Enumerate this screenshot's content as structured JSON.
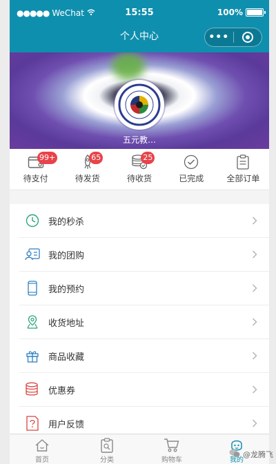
{
  "status_bar": {
    "carrier": "WeChat",
    "time": "15:55",
    "battery": "100%"
  },
  "nav": {
    "title": "个人中心",
    "more_icon": "more-dots-icon",
    "close_icon": "close-ring-icon"
  },
  "profile": {
    "username": "五元教…"
  },
  "orders": [
    {
      "label": "待支付",
      "badge": "99+",
      "icon": "wallet-icon"
    },
    {
      "label": "待发货",
      "badge": "65",
      "icon": "rocket-icon"
    },
    {
      "label": "待收货",
      "badge": "25",
      "icon": "coins-icon"
    },
    {
      "label": "已完成",
      "badge": "",
      "icon": "check-circle-icon"
    },
    {
      "label": "全部订单",
      "badge": "",
      "icon": "clipboard-icon"
    }
  ],
  "menu": [
    {
      "label": "我的秒杀",
      "icon": "clock-icon",
      "color": "#2aa57a"
    },
    {
      "label": "我的团购",
      "icon": "group-card-icon",
      "color": "#2f7fbf"
    },
    {
      "label": "我的预约",
      "icon": "phone-icon",
      "color": "#2f7fbf"
    },
    {
      "label": "收货地址",
      "icon": "location-icon",
      "color": "#2aa57a"
    },
    {
      "label": "商品收藏",
      "icon": "gift-icon",
      "color": "#2f7fbf"
    },
    {
      "label": "优惠券",
      "icon": "coupon-stack-icon",
      "color": "#d9443f"
    },
    {
      "label": "用户反馈",
      "icon": "feedback-icon",
      "color": "#d9443f"
    }
  ],
  "tabbar": [
    {
      "label": "首页",
      "icon": "home-icon",
      "active": false
    },
    {
      "label": "分类",
      "icon": "category-icon",
      "active": false
    },
    {
      "label": "购物车",
      "icon": "cart-icon",
      "active": false
    },
    {
      "label": "我的",
      "icon": "profile-face-icon",
      "active": true
    }
  ],
  "watermark": {
    "text": "@龙腾飞"
  },
  "colors": {
    "primary": "#0f8fae",
    "badge": "#e8434a"
  }
}
